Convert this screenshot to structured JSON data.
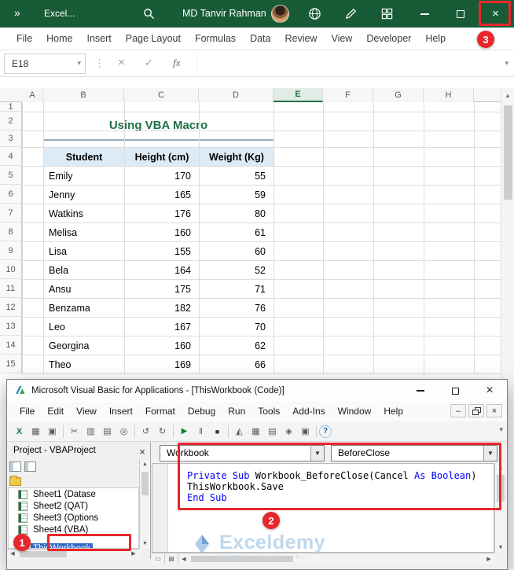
{
  "colors": {
    "excel_green": "#185c37",
    "accent_green": "#217346",
    "annotation_red": "#e8262c",
    "selection_blue": "#316ac5",
    "keyword_blue": "#0000ff",
    "table_header_fill": "#ddebf7",
    "watermark_blue": "#b9d4ec"
  },
  "excel": {
    "titlebar": {
      "overflow_chevron": "»",
      "app_label": "Excel...",
      "user_name": "MD Tanvir Rahman"
    },
    "menus": [
      "File",
      "Home",
      "Insert",
      "Page Layout",
      "Formulas",
      "Data",
      "Review",
      "View",
      "Developer",
      "Help"
    ],
    "name_box": "E18",
    "formula_bar": {
      "cancel": "×",
      "enter": "✓",
      "fx": "fx"
    },
    "column_headers": [
      "A",
      "B",
      "C",
      "D",
      "E",
      "F",
      "G",
      "H"
    ],
    "selected_column": "E",
    "row_numbers": [
      "1",
      "2",
      "3",
      "4",
      "5",
      "6",
      "7",
      "8",
      "9",
      "10",
      "11",
      "12",
      "13",
      "14",
      "15"
    ],
    "sheet_title": "Using VBA Macro",
    "table": {
      "headers": [
        "Student",
        "Height (cm)",
        "Weight (Kg)"
      ],
      "rows": [
        [
          "Emily",
          "170",
          "55"
        ],
        [
          "Jenny",
          "165",
          "59"
        ],
        [
          "Watkins",
          "176",
          "80"
        ],
        [
          "Melisa",
          "160",
          "61"
        ],
        [
          "Lisa",
          "155",
          "60"
        ],
        [
          "Bela",
          "164",
          "52"
        ],
        [
          "Ansu",
          "175",
          "71"
        ],
        [
          "Benzama",
          "182",
          "76"
        ],
        [
          "Leo",
          "167",
          "70"
        ],
        [
          "Georgina",
          "160",
          "62"
        ],
        [
          "Theo",
          "169",
          "66"
        ]
      ]
    }
  },
  "vba": {
    "title": "Microsoft Visual Basic for Applications - [ThisWorkbook (Code)]",
    "menus": [
      "File",
      "Edit",
      "View",
      "Insert",
      "Format",
      "Debug",
      "Run",
      "Tools",
      "Add-Ins",
      "Window",
      "Help"
    ],
    "toolbar_icons": [
      "view-excel-icon",
      "insert-userform-icon",
      "save-icon",
      "cut-icon",
      "copy-icon",
      "paste-icon",
      "find-icon",
      "undo-icon",
      "redo-icon",
      "run-icon",
      "break-icon",
      "reset-icon",
      "design-mode-icon",
      "project-explorer-icon",
      "properties-window-icon",
      "object-browser-icon",
      "toolbox-icon",
      "help-icon"
    ],
    "project": {
      "title": "Project - VBAProject",
      "tool_icons": [
        "view-code-icon",
        "view-object-icon",
        "toggle-folders-icon"
      ],
      "tree": [
        {
          "label": "Sheet1 (Datase",
          "selected": false
        },
        {
          "label": "Sheet2 (QAT)",
          "selected": false
        },
        {
          "label": "Sheet3 (Options",
          "selected": false
        },
        {
          "label": "Sheet4 (VBA)",
          "selected": false
        },
        {
          "label": "ThisWorkbook",
          "selected": true
        }
      ]
    },
    "object_dropdown": "Workbook",
    "procedure_dropdown": "BeforeClose",
    "code_lines": [
      {
        "tokens": [
          {
            "text": "Private Sub ",
            "type": "keyword"
          },
          {
            "text": "Workbook_BeforeClose(Cancel ",
            "type": "normal"
          },
          {
            "text": "As Boolean",
            "type": "keyword"
          },
          {
            "text": ")",
            "type": "normal"
          }
        ]
      },
      {
        "tokens": [
          {
            "text": "ThisWorkbook.Save",
            "type": "normal"
          }
        ]
      },
      {
        "tokens": [
          {
            "text": "End Sub",
            "type": "keyword"
          }
        ]
      }
    ]
  },
  "watermark": {
    "name": "Exceldemy",
    "tagline": "EXCEL - DATA - BI"
  },
  "annotations": {
    "step1": "1",
    "step2": "2",
    "step3": "3"
  }
}
